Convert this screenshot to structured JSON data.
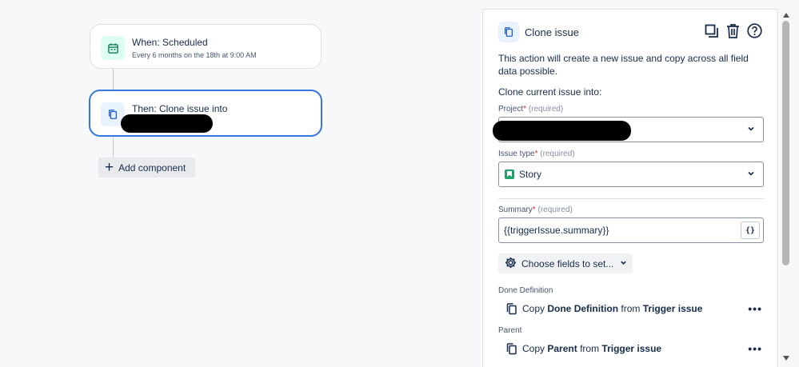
{
  "canvas": {
    "trigger": {
      "title": "When: Scheduled",
      "subtitle": "Every 6 months on the 18th at 9:00 AM",
      "icon": "calendar-icon"
    },
    "action": {
      "title": "Then: Clone issue into",
      "icon": "copy-icon"
    },
    "add_component_label": "Add component"
  },
  "panel": {
    "title": "Clone issue",
    "header_icons": [
      "duplicate-icon",
      "trash-icon",
      "help-icon"
    ],
    "description": "This action will create a new issue and copy across all field data possible.",
    "clone_into_label": "Clone current issue into:",
    "project": {
      "label": "Project",
      "required_marker": "*",
      "required_text": "(required)"
    },
    "issue_type": {
      "label": "Issue type",
      "required_marker": "*",
      "required_text": "(required)",
      "value": "Story"
    },
    "summary": {
      "label": "Summary",
      "required_marker": "*",
      "required_text": "(required)",
      "value": "{{triggerIssue.summary}}",
      "smart_value_button": "{}"
    },
    "choose_fields_label": "Choose fields to set...",
    "sections": [
      {
        "label": "Done Definition",
        "copy_prefix": "Copy",
        "field": "Done Definition",
        "from_text": "from",
        "source": "Trigger issue",
        "more": "•••"
      },
      {
        "label": "Parent",
        "copy_prefix": "Copy",
        "field": "Parent",
        "from_text": "from",
        "source": "Trigger issue",
        "more": "•••"
      }
    ]
  },
  "colors": {
    "accent": "#3577e0",
    "story": "#22a06b",
    "required": "#c9372c"
  }
}
